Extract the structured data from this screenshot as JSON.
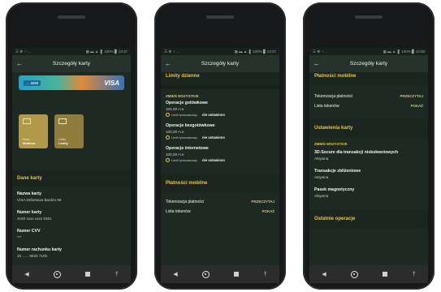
{
  "statusbar": {
    "s1_left": "☰ ☸ ♂ ...",
    "s1_right": "▩ ▬ ▲ .▌ 100% ▊ 13:37",
    "s2_left": "☰ ☸ ♂ ...",
    "s2_right": "▩ ▬ ▲ .▌ 100% ▊ 13:37",
    "s3_left": "☰ ☸ ♂ ...",
    "s3_right": "▩ ▬ ▲ .▌ 100% ▊ 13:38"
  },
  "appbar": {
    "title": "Szczegóły karty"
  },
  "screen1": {
    "card": {
      "number": ".... 5869",
      "brand": "VISA"
    },
    "tiles": [
      {
        "label": "Karta",
        "value": "Mobilna"
      },
      {
        "label": "Limity",
        "value": "Limity"
      }
    ],
    "section_title": "Dane karty",
    "rows": [
      {
        "label": "Nazwa karty",
        "value": "VISA Debetowa Bardzo 69"
      },
      {
        "label": "Numer karty",
        "value": "4160 xxxx xxxx 5361"
      },
      {
        "label": "Numer CVV",
        "value": "***"
      },
      {
        "label": "Numer rachunku karty",
        "value": "33 ...... 9633 7105"
      }
    ]
  },
  "screen2": {
    "section_title": "Limity dzienne",
    "change_all": "ZMIEŃ WSZYSTKIE",
    "limits": [
      {
        "title": "Operacje gotówkowe",
        "amount": "100,00",
        "unit": "PLN",
        "temp_label": "Limit tymczasowy:",
        "temp_value": "nie ustawiono"
      },
      {
        "title": "Operacje bezgotówkowe",
        "amount": "100,00",
        "unit": "PLN",
        "temp_label": "Limit tymczasowy:",
        "temp_value": "nie ustawiono"
      },
      {
        "title": "Operacje internetowe",
        "amount": "100,00",
        "unit": "PLN",
        "temp_label": "Limit tymczasowy:",
        "temp_value": "nie ustawiono"
      }
    ],
    "mobile_title": "Płatności mobilne",
    "mobile_rows": [
      {
        "label": "Tokenizacja płatności",
        "action": "PRZECZYTAJ"
      },
      {
        "label": "Lista tokenów",
        "action": "POKAŻ"
      }
    ]
  },
  "screen3": {
    "mobile_title": "Płatności mobilne",
    "mobile_rows": [
      {
        "label": "Tokenizacja płatności",
        "action": "PRZECZYTAJ"
      },
      {
        "label": "Lista tokenów",
        "action": "POKAŻ"
      }
    ],
    "settings_title": "Ustawienia karty",
    "change_all": "ZMIEŃ WSZYSTKIE",
    "settings": [
      {
        "label": "3D-Secure dla transakcji niskokwotowych",
        "value": "Aktywna"
      },
      {
        "label": "Transakcje zbliżeniowe",
        "value": "Aktywna"
      },
      {
        "label": "Pasek magnetyczny",
        "value": "Aktywna"
      }
    ],
    "recent_title": "Ostatnie operacje"
  },
  "navbar": {
    "back": "◀",
    "a11y": "†"
  }
}
